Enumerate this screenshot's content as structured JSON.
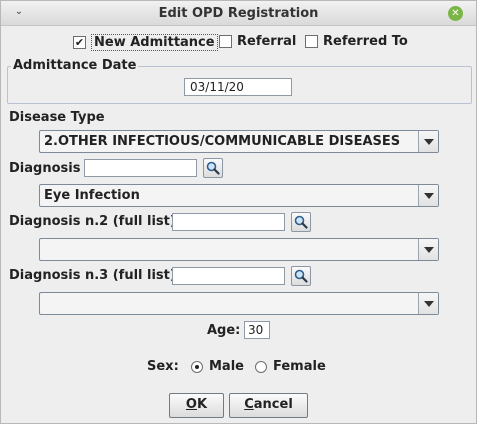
{
  "window": {
    "title": "Edit OPD Registration",
    "menu_glyph": "⌄",
    "close_glyph": "✕"
  },
  "checkboxes": [
    {
      "label": "New Admittance",
      "checked": true
    },
    {
      "label": "Referral",
      "checked": false
    },
    {
      "label": "Referred To",
      "checked": false
    }
  ],
  "admittance": {
    "group_label": "Admittance Date",
    "date_value": "03/11/20"
  },
  "disease_type": {
    "label": "Disease Type",
    "selected": "2.OTHER INFECTIOUS/COMMUNICABLE DISEASES"
  },
  "diagnosis1": {
    "label": "Diagnosis",
    "search_value": "",
    "selected": "Eye Infection"
  },
  "diagnosis2": {
    "label": "Diagnosis n.2 (full list)",
    "search_value": "",
    "selected": ""
  },
  "diagnosis3": {
    "label": "Diagnosis n.3 (full list)",
    "search_value": "",
    "selected": ""
  },
  "age": {
    "label": "Age:",
    "value": "30"
  },
  "sex": {
    "label": "Sex:",
    "options": [
      {
        "label": "Male",
        "selected": true
      },
      {
        "label": "Female",
        "selected": false
      }
    ]
  },
  "buttons": {
    "ok_mnemonic": "O",
    "ok_rest": "K",
    "cancel_mnemonic": "C",
    "cancel_rest": "ancel"
  }
}
